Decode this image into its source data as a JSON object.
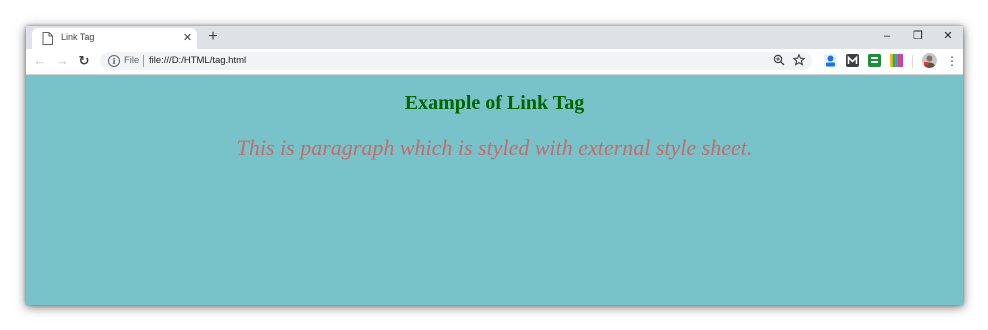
{
  "browser": {
    "tab": {
      "title": "Link Tag",
      "close_glyph": "✕",
      "icon": "page-icon"
    },
    "new_tab_glyph": "+",
    "window_controls": {
      "minimize": "–",
      "restore": "❐",
      "close": "✕"
    },
    "nav": {
      "back": "←",
      "forward": "→",
      "reload": "↻"
    },
    "address_bar": {
      "scheme_label": "File",
      "url": "file:///D:/HTML/tag.html"
    },
    "toolbar_icons": [
      "zoom-icon",
      "star-icon",
      "extension-icons",
      "profile-avatar",
      "menu-icon"
    ],
    "menu_glyph": "⋮"
  },
  "page": {
    "background": "#78c2ca",
    "heading": {
      "text": "Example of Link Tag",
      "color": "#006400"
    },
    "paragraph": {
      "text": "This is paragraph which is styled with external style sheet.",
      "color": "#c66b6b"
    }
  }
}
